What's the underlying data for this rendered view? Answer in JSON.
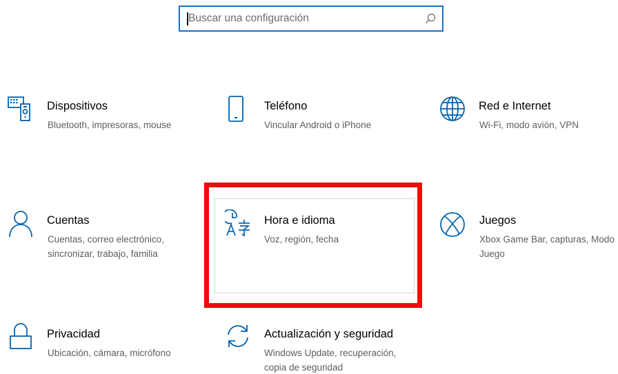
{
  "search": {
    "placeholder": "Buscar una configuración",
    "icon": "search-icon"
  },
  "tiles": [
    {
      "title": "Dispositivos",
      "desc": [
        "Bluetooth, impresoras, mouse"
      ],
      "icon": "devices-icon"
    },
    {
      "title": "Teléfono",
      "desc": [
        "Vincular Android o iPhone"
      ],
      "icon": "phone-icon"
    },
    {
      "title": "Red e Internet",
      "desc": [
        "Wi-Fi, modo avión, VPN"
      ],
      "icon": "globe-icon"
    },
    {
      "title": "Cuentas",
      "desc": [
        "Cuentas, correo electrónico,",
        "sincronizar, trabajo, familia"
      ],
      "icon": "person-icon"
    },
    {
      "title": "Hora e idioma",
      "desc": [
        "Voz, región, fecha"
      ],
      "icon": "time-language-icon"
    },
    {
      "title": "Juegos",
      "desc": [
        "Xbox Game Bar, capturas, Modo",
        "Juego"
      ],
      "icon": "xbox-icon"
    },
    {
      "title": "Privacidad",
      "desc": [
        "Ubicación, cámara, micrófono"
      ],
      "icon": "lock-icon"
    },
    {
      "title": "Actualización y seguridad",
      "desc": [
        "Windows Update, recuperación,",
        "copia de seguridad"
      ],
      "icon": "sync-icon"
    }
  ],
  "colors": {
    "accent": "#0063b1",
    "highlight": "#f00a0a",
    "search_border": "#1a73c6"
  }
}
